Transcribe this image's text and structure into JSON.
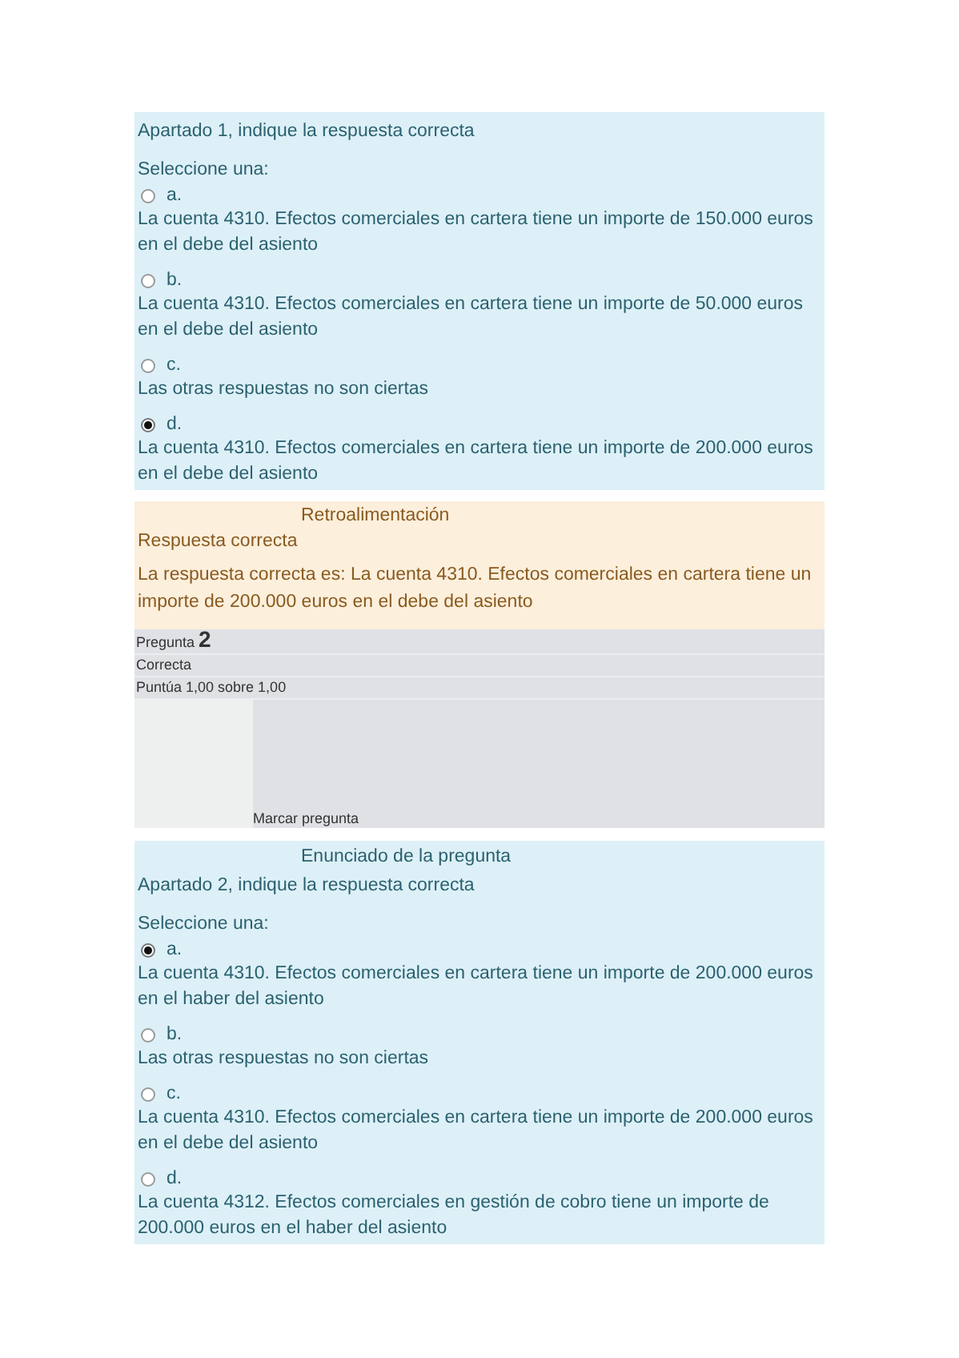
{
  "question_1": {
    "prompt": "Apartado 1, indique la respuesta correcta",
    "select_label": "Seleccione una:",
    "options": [
      {
        "letter": "a.",
        "text": "La cuenta 4310. Efectos comerciales en cartera tiene un importe de 150.000 euros en el debe del asiento",
        "selected": false
      },
      {
        "letter": "b.",
        "text": "La cuenta 4310. Efectos comerciales en cartera tiene un importe de 50.000 euros en el debe del asiento",
        "selected": false
      },
      {
        "letter": "c.",
        "text": "Las otras respuestas no son ciertas",
        "selected": false
      },
      {
        "letter": "d.",
        "text": "La cuenta 4310. Efectos comerciales en cartera tiene un importe de 200.000 euros en el debe del asiento",
        "selected": true
      }
    ]
  },
  "feedback": {
    "heading": "Retroalimentación",
    "status": "Respuesta correcta",
    "answer": "La respuesta correcta es: La cuenta 4310. Efectos comerciales en cartera tiene un importe de 200.000 euros en el debe del asiento"
  },
  "question_2_info": {
    "label": "Pregunta",
    "number": "2",
    "state": "Correcta",
    "score": "Puntúa 1,00 sobre 1,00",
    "flag": "Marcar pregunta"
  },
  "question_2": {
    "heading": "Enunciado de la pregunta",
    "prompt": "Apartado 2, indique la respuesta correcta",
    "select_label": "Seleccione una:",
    "options": [
      {
        "letter": "a.",
        "text": "La cuenta 4310. Efectos comerciales en cartera tiene un importe de 200.000 euros en el haber del asiento",
        "selected": true
      },
      {
        "letter": "b.",
        "text": "Las otras respuestas no son ciertas",
        "selected": false
      },
      {
        "letter": "c.",
        "text": "La cuenta 4310. Efectos comerciales en cartera tiene un importe de 200.000 euros en el debe del asiento",
        "selected": false
      },
      {
        "letter": "d.",
        "text": "La cuenta 4312. Efectos comerciales en gestión de cobro tiene un importe de 200.000 euros en el haber del asiento",
        "selected": false
      }
    ]
  }
}
